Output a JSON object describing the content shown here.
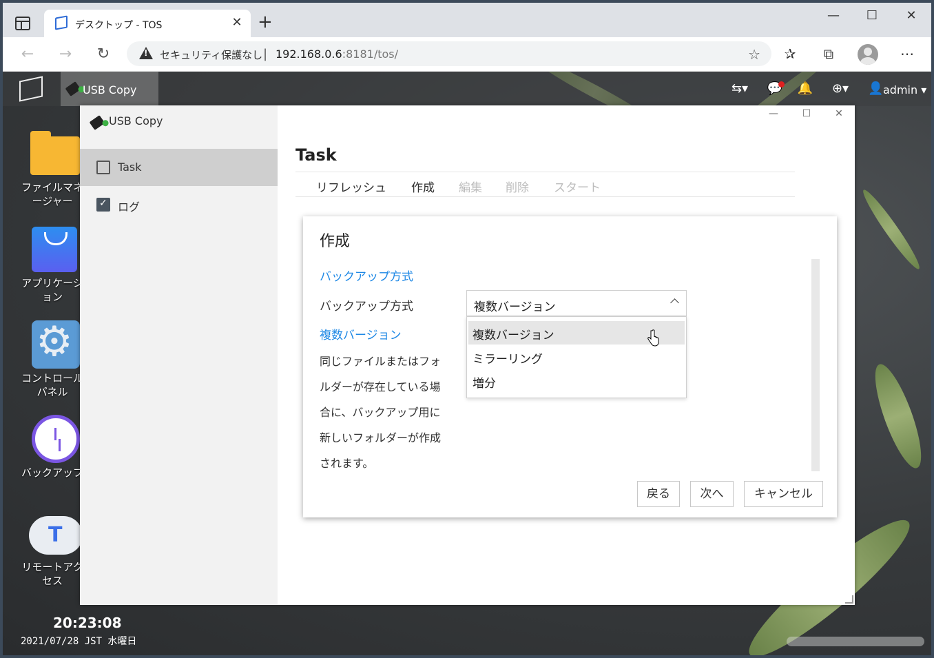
{
  "browser": {
    "tab_title": "デスクトップ - TOS",
    "tab_close": "✕",
    "new_tab": "+",
    "security_label": "セキュリティ保護なし",
    "url_host": "192.168.0.6",
    "url_rest": ":8181/tos/",
    "window_controls": {
      "minimize": "—",
      "maximize": "☐",
      "close": "✕"
    }
  },
  "taskbar": {
    "app_label": "USB Copy",
    "user_label": "admin"
  },
  "desktop": {
    "icons": [
      {
        "label": "ファイルマネージャー"
      },
      {
        "label": "アプリケーション"
      },
      {
        "label": "コントロールパネル"
      },
      {
        "label": "バックアップ"
      },
      {
        "label": "リモートアクセス"
      }
    ],
    "time": "20:23:08",
    "date": "2021/07/28 JST 水曜日"
  },
  "app": {
    "title": "USB Copy",
    "sidebar": [
      {
        "label": "Task",
        "active": true
      },
      {
        "label": "ログ",
        "active": false
      }
    ],
    "main_title": "Task",
    "toolbar": {
      "refresh": "リフレッシュ",
      "create": "作成",
      "edit": "編集",
      "delete": "削除",
      "start": "スタート"
    }
  },
  "dialog": {
    "title": "作成",
    "section_backup": "バックアップ方式",
    "field_label": "バックアップ方式",
    "selected_value": "複数バージョン",
    "options": [
      "複数バージョン",
      "ミラーリング",
      "増分"
    ],
    "section_mode": "複数バージョン",
    "description_lines": [
      "同じファイルまたはフォ",
      "ルダーが存在している場",
      "合に、バックアップ用に",
      "新しいフォルダーが作成",
      "されます。"
    ],
    "buttons": {
      "back": "戻る",
      "next": "次へ",
      "cancel": "キャンセル"
    }
  }
}
